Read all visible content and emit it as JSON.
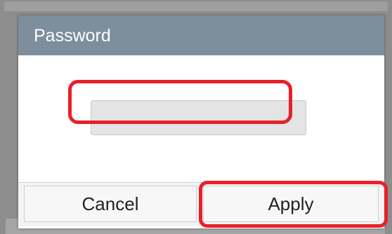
{
  "dialog": {
    "title": "Password",
    "password_value": "",
    "cancel_label": "Cancel",
    "apply_label": "Apply"
  },
  "colors": {
    "header_bg": "#7d8e9d",
    "input_bg": "#e3e4e5",
    "highlight": "#e8202a"
  }
}
